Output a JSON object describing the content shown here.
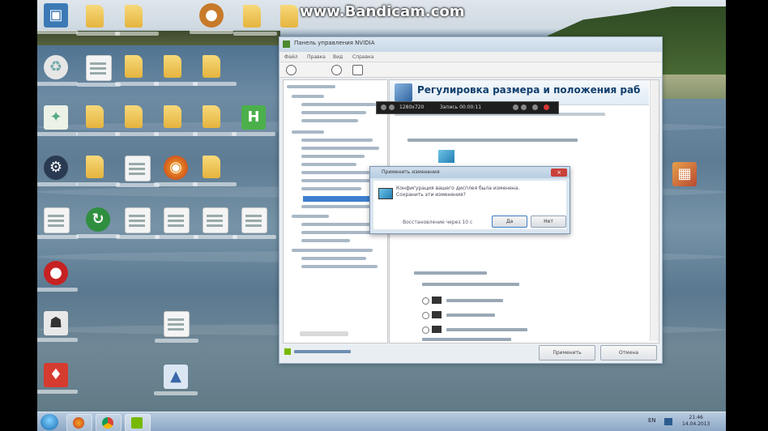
{
  "watermark": "www.Bandicam.com",
  "nvidia_window": {
    "title": "Панель управления NVIDIA",
    "menu": [
      "Файл",
      "Правка",
      "Вид",
      "Справка"
    ],
    "panel_title": "Регулировка размера и положения раб",
    "buttons": {
      "apply": "Применить",
      "cancel": "Отмена"
    }
  },
  "bandicam_bar": {
    "resolution": "1280x720",
    "record_label": "Запись 00:00:11"
  },
  "dialog": {
    "title": "Применить изменения",
    "message": "Конфигурация вашего дисплея была изменена. Сохранить эти изменения?",
    "countdown": "Восстановление через 10 с",
    "yes_label": "Да",
    "no_label": "Нет",
    "close_glyph": "×"
  },
  "taskbar": {
    "language": "EN",
    "time": "21:46",
    "date": "14.04.2013"
  },
  "colors": {
    "nvidia_green": "#76b900",
    "title_blue": "#12406e",
    "close_red": "#c9413a"
  }
}
